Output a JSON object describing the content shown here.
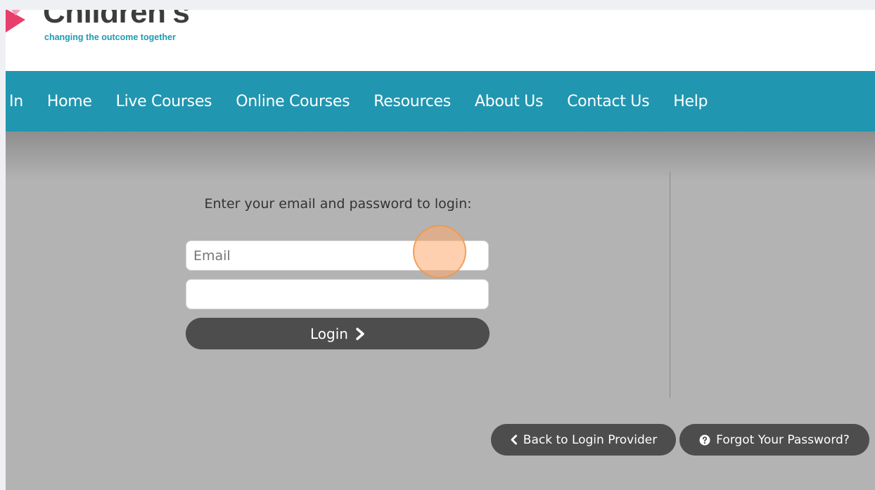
{
  "header": {
    "logo_word": "Children's",
    "logo_tagline": "changing the outcome together"
  },
  "nav": {
    "items": [
      "In",
      "Home",
      "Live Courses",
      "Online Courses",
      "Resources",
      "About Us",
      "Contact Us",
      "Help"
    ]
  },
  "login": {
    "prompt": "Enter your email and password to login:",
    "email_placeholder": "Email",
    "email_value": "",
    "password_value": "",
    "login_label": "Login"
  },
  "actions": {
    "back_label": "Back to Login Provider",
    "forgot_label": "Forgot Your Password?"
  },
  "colors": {
    "nav_bg": "#2196b0",
    "page_bg": "#b3b3b3",
    "button_bg": "#4d4d4d",
    "tagline": "#1f9bb0",
    "logo_mark": "#e83e6c"
  },
  "icons": {
    "login": "chevron-right-icon",
    "back": "chevron-left-icon",
    "forgot": "question-circle-icon"
  }
}
